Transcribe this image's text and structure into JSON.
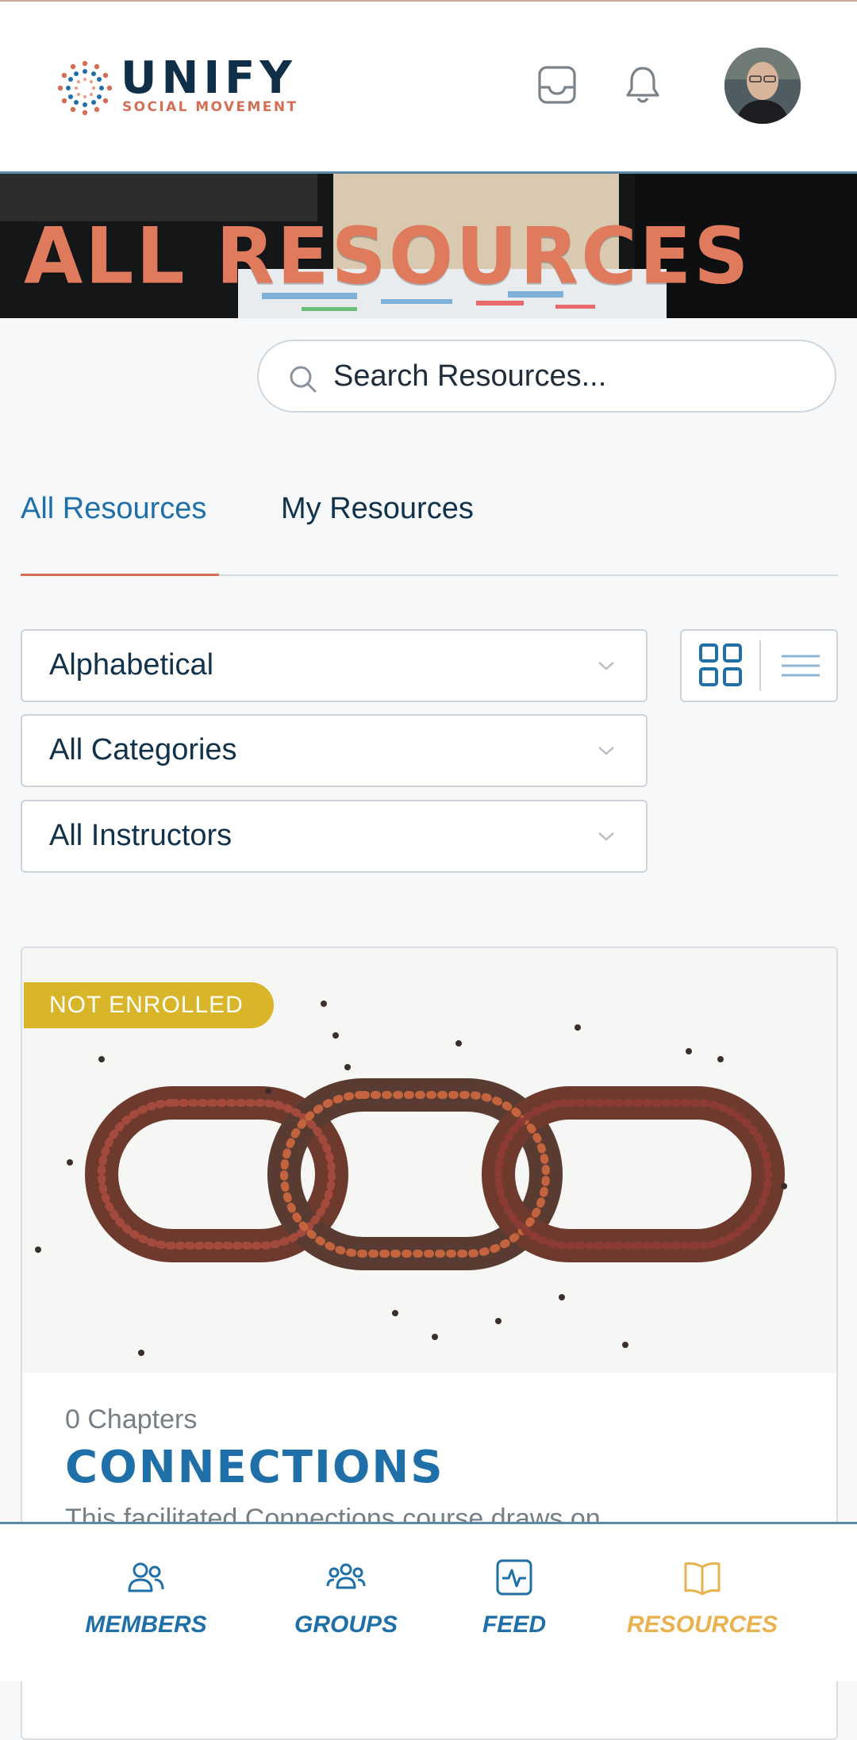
{
  "header": {
    "logo_title": "UNIFY",
    "logo_subtitle": "SOCIAL MOVEMENT",
    "inbox_icon": "inbox-icon",
    "bell_icon": "bell-icon"
  },
  "banner": {
    "title": "ALL RESOURCES"
  },
  "search": {
    "placeholder": "Search Resources..."
  },
  "tabs": [
    {
      "label": "All Resources",
      "active": true
    },
    {
      "label": "My Resources",
      "active": false
    }
  ],
  "filters": {
    "sort": "Alphabetical",
    "category": "All Categories",
    "instructor": "All Instructors"
  },
  "card": {
    "badge": "NOT ENROLLED",
    "chapters": "0 Chapters",
    "title": "CONNECTIONS",
    "description": "This facilitated Connections course draws on"
  },
  "bottom_nav": [
    {
      "label": "MEMBERS",
      "icon": "members-icon",
      "active": false
    },
    {
      "label": "GROUPS",
      "icon": "groups-icon",
      "active": false
    },
    {
      "label": "FEED",
      "icon": "feed-icon",
      "active": false
    },
    {
      "label": "RESOURCES",
      "icon": "book-icon",
      "active": true
    }
  ],
  "colors": {
    "brand_navy": "#0f2f49",
    "brand_blue": "#1f6fa8",
    "accent_coral": "#d46f55",
    "accent_gold": "#e8b24f",
    "badge_yellow": "#d9b52a"
  }
}
